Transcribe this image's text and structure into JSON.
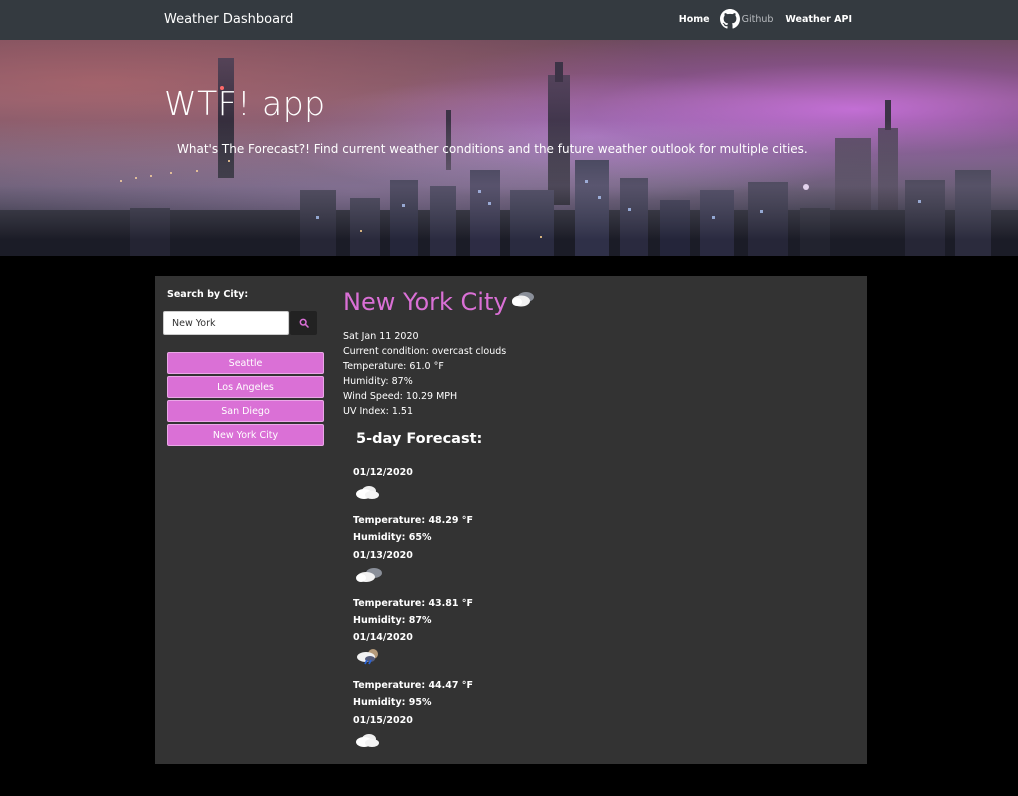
{
  "navbar": {
    "brand": "Weather Dashboard",
    "links": {
      "home": "Home",
      "github": "Github",
      "weather_api": "Weather API"
    }
  },
  "hero": {
    "title": "WTF! app",
    "subtitle": "What's The Forecast?! Find current weather conditions and the future weather outlook for multiple cities."
  },
  "search": {
    "label": "Search by City:",
    "value": "New York",
    "button_icon": "search-icon"
  },
  "saved_cities": [
    "Seattle",
    "Los Angeles",
    "San Diego",
    "New York City"
  ],
  "current": {
    "city": "New York City",
    "icon": "cloud-icon",
    "date": "Sat Jan 11 2020",
    "condition": "Current condition: overcast clouds",
    "temperature": "Temperature: 61.0 °F",
    "humidity": "Humidity: 87%",
    "wind": "Wind Speed: 10.29 MPH",
    "uv": "UV Index: 1.51"
  },
  "forecast": {
    "heading": "5-day Forecast:",
    "days": [
      {
        "date": "01/12/2020",
        "icon": "cloud-icon",
        "temperature": "Temperature: 48.29 °F",
        "humidity": "Humidity: 65%"
      },
      {
        "date": "01/13/2020",
        "icon": "cloud-icon",
        "temperature": "Temperature: 43.81 °F",
        "humidity": "Humidity: 87%"
      },
      {
        "date": "01/14/2020",
        "icon": "rain-cloud-icon",
        "temperature": "Temperature: 44.47 °F",
        "humidity": "Humidity: 95%"
      },
      {
        "date": "01/15/2020",
        "icon": "cloud-icon"
      }
    ]
  },
  "colors": {
    "accent": "#da70d6",
    "navbar": "#343a40",
    "panel": "#333333",
    "page": "#000000"
  }
}
